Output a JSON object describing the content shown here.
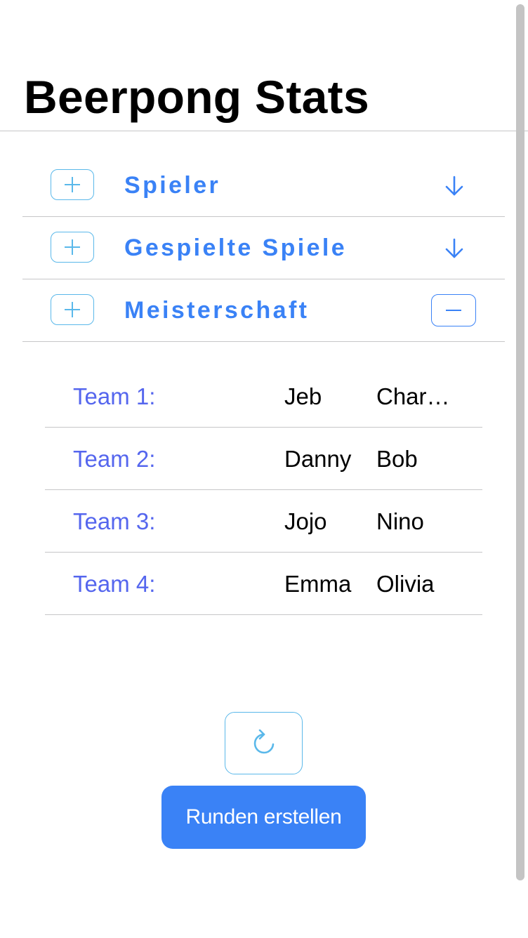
{
  "app": {
    "title": "Beerpong Stats"
  },
  "sections": [
    {
      "label": "Spieler",
      "state": "collapsed",
      "toggle_icon": "arrow-down-icon",
      "add_icon": "plus-icon"
    },
    {
      "label": "Gespielte Spiele",
      "state": "collapsed",
      "toggle_icon": "arrow-down-icon",
      "add_icon": "plus-icon"
    },
    {
      "label": "Meisterschaft",
      "state": "expanded",
      "toggle_icon": "minus-icon",
      "add_icon": "plus-icon"
    }
  ],
  "teams": [
    {
      "label": "Team 1:",
      "player1": "Jeb",
      "player2": "Char…"
    },
    {
      "label": "Team 2:",
      "player1": "Danny",
      "player2": "Bob"
    },
    {
      "label": "Team 3:",
      "player1": "Jojo",
      "player2": "Nino"
    },
    {
      "label": "Team 4:",
      "player1": "Emma",
      "player2": "Olivia"
    }
  ],
  "actions": {
    "refresh_icon": "refresh-icon",
    "create_rounds_label": "Runden erstellen"
  },
  "colors": {
    "accent": "#3a82f6",
    "team_label": "#5566ee",
    "icon_outline": "#5ab8ea",
    "divider": "#c6c6c8"
  }
}
